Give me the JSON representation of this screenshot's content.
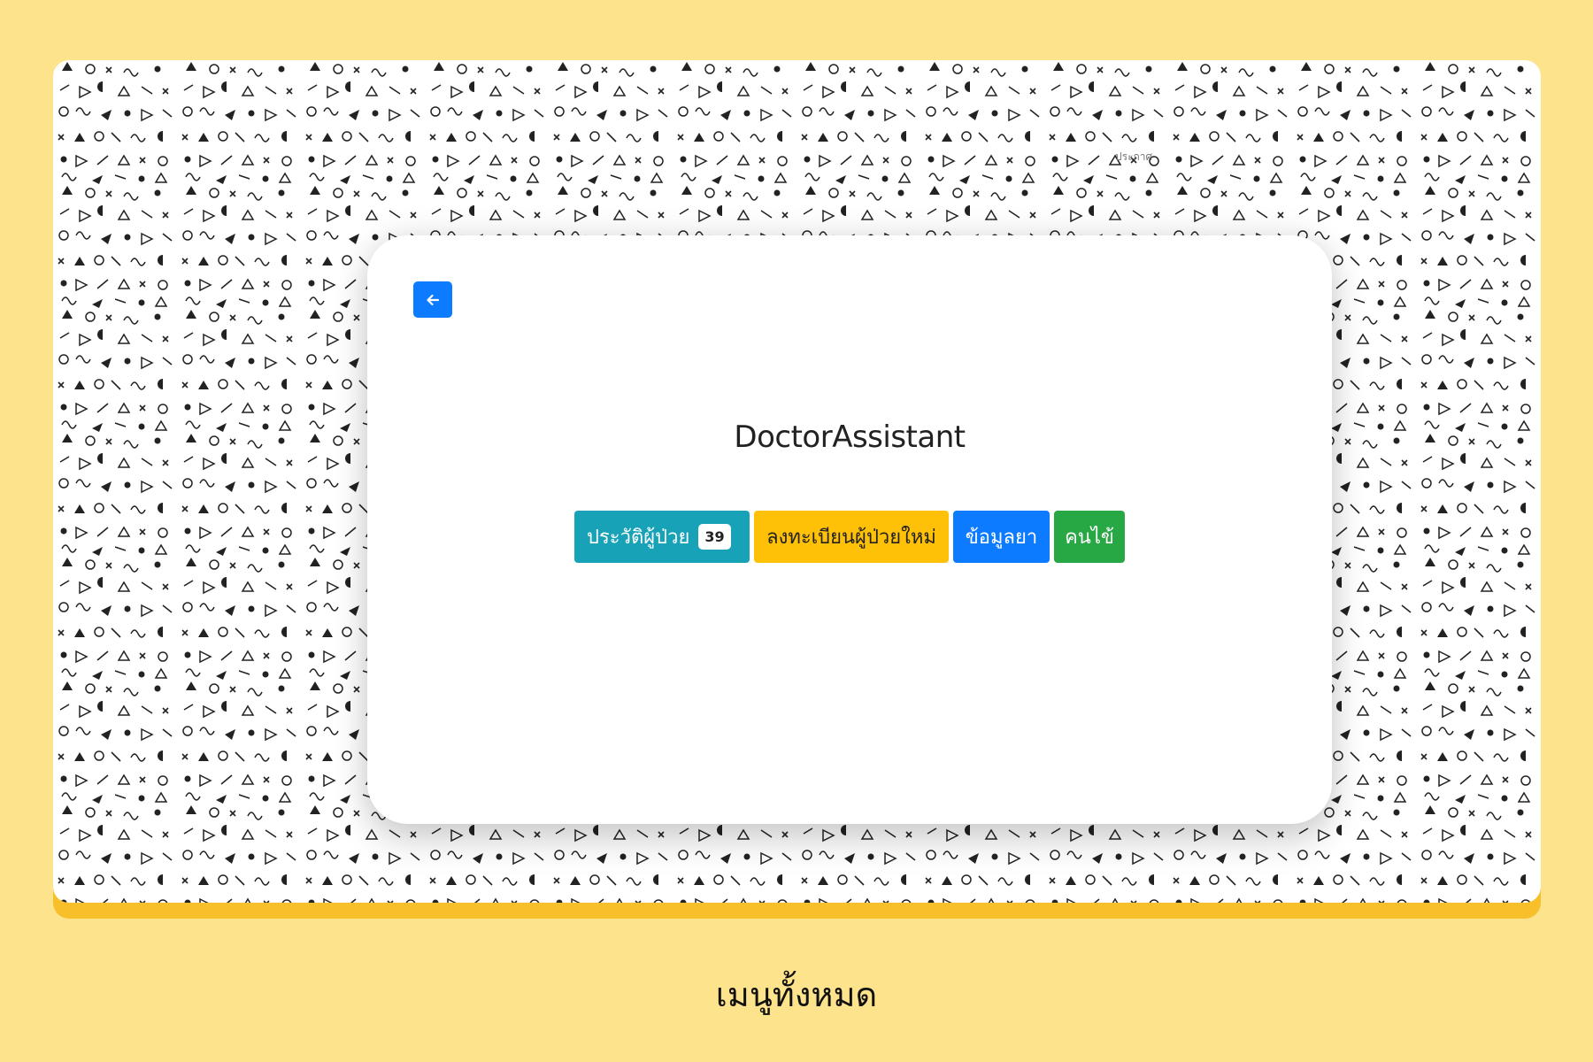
{
  "header": {
    "corner_text": "ประกาศ"
  },
  "card": {
    "back_icon": "arrow-left-icon",
    "title": "DoctorAssistant",
    "menu": {
      "history_label": "ประวัติผู้ป่วย",
      "history_count": "39",
      "register_label": "ลงทะเบียนผู้ป่วยใหม่",
      "drug_label": "ข้อมูลยา",
      "fever_label": "คนไข้"
    }
  },
  "caption": "เมนูทั้งหมด",
  "colors": {
    "page_background": "#fde38c",
    "frame_accent": "#f7c02a",
    "history_button": "#17a2b8",
    "register_button": "#ffc107",
    "drug_button": "#0d7bff",
    "fever_button": "#28a745",
    "back_button": "#0d7bff"
  }
}
